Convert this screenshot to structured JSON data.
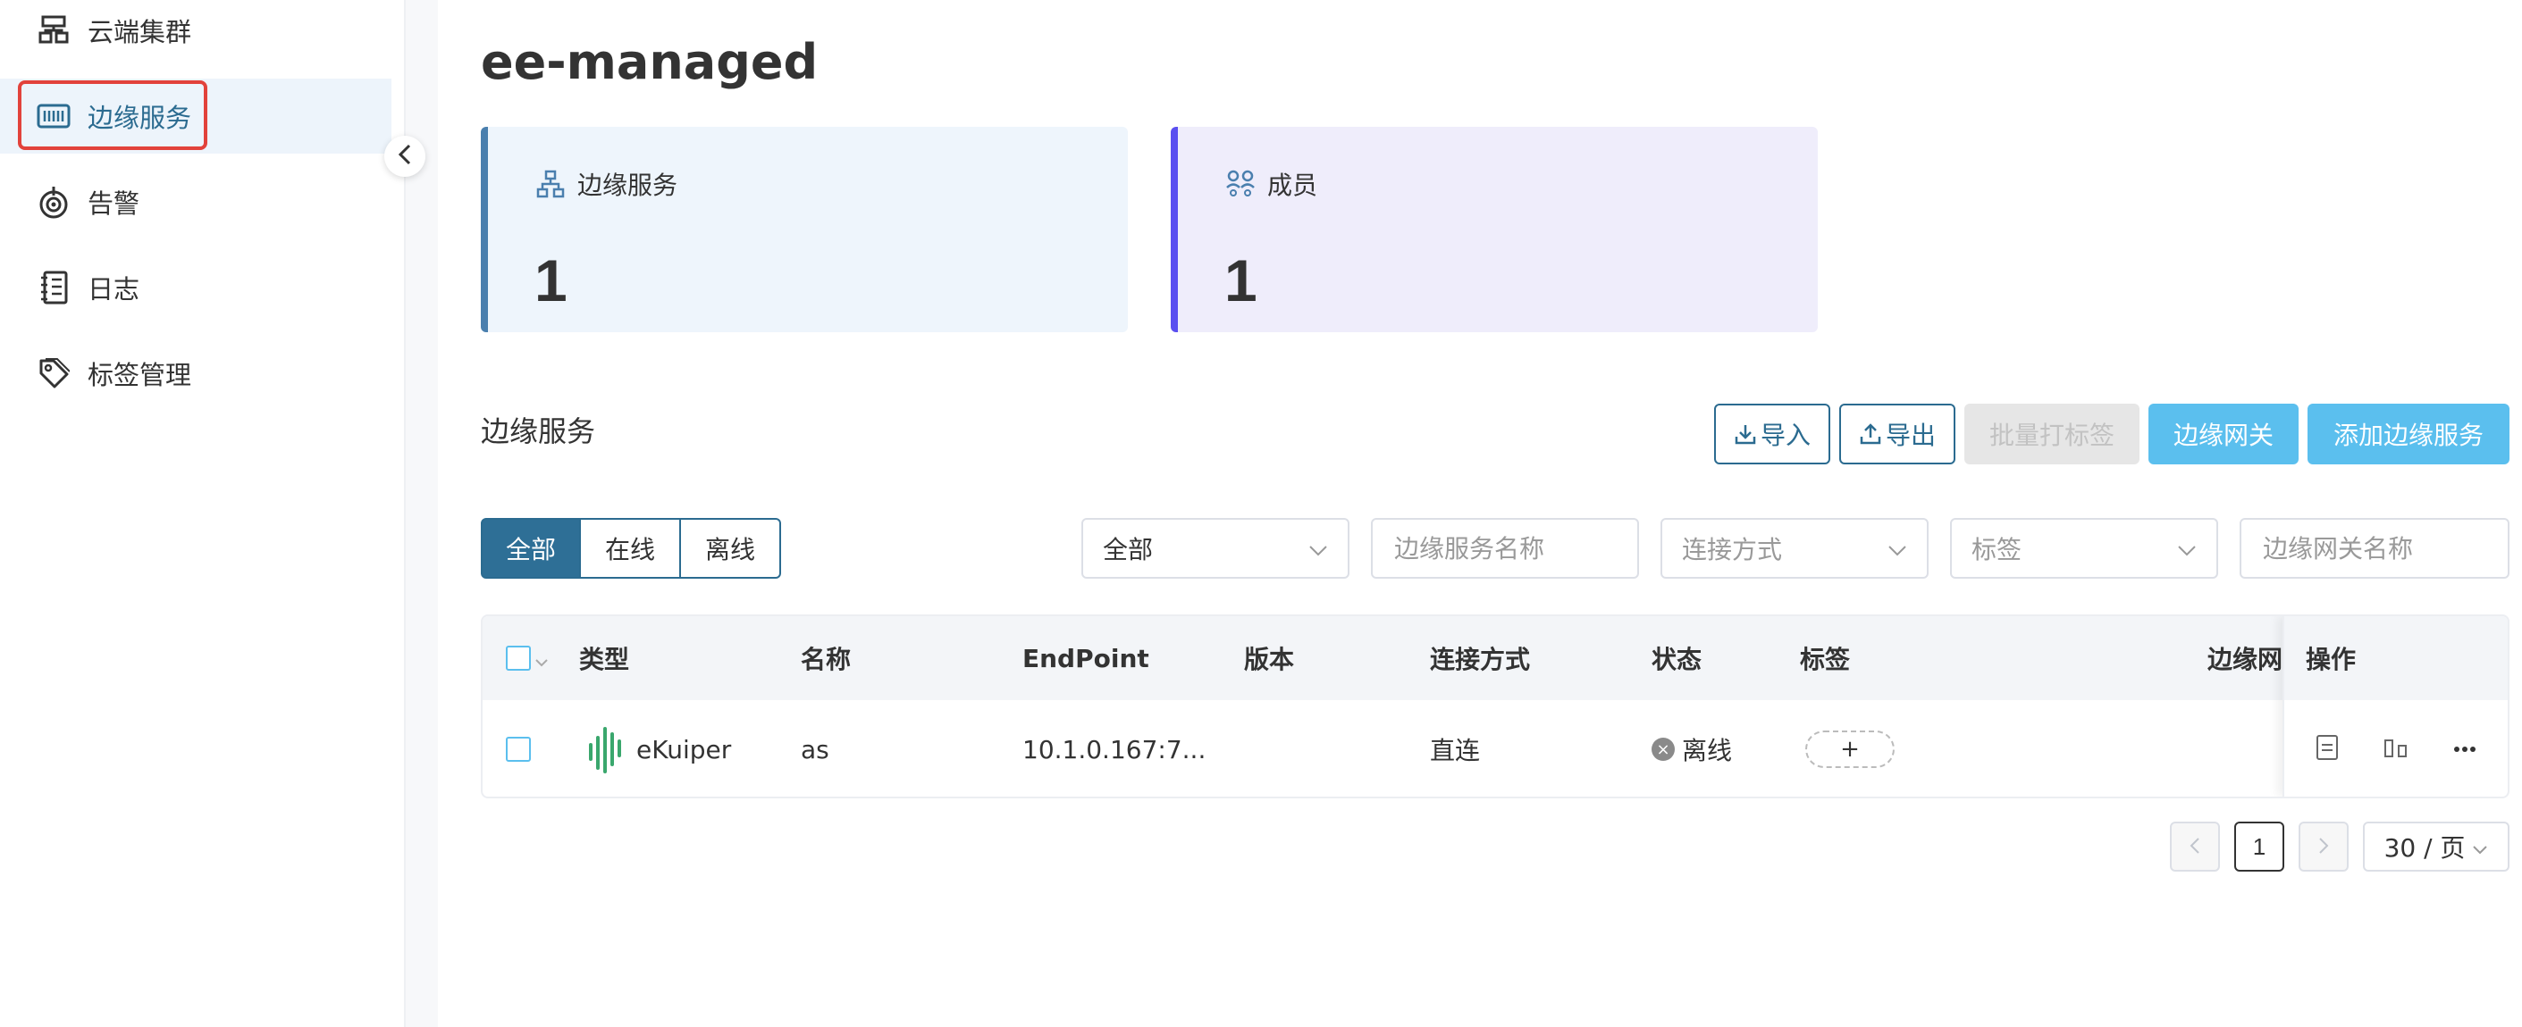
{
  "sidebar": {
    "items": [
      {
        "label": "云端集群",
        "icon": "cluster-icon"
      },
      {
        "label": "边缘服务",
        "icon": "edge-service-icon",
        "active": true
      },
      {
        "label": "告警",
        "icon": "alarm-icon"
      },
      {
        "label": "日志",
        "icon": "log-icon"
      },
      {
        "label": "标签管理",
        "icon": "tag-icon"
      }
    ]
  },
  "page": {
    "title": "ee-managed"
  },
  "stats": {
    "services": {
      "label": "边缘服务",
      "value": "1",
      "icon": "sitemap-icon",
      "accent": "#4a7fae"
    },
    "members": {
      "label": "成员",
      "value": "1",
      "icon": "members-icon",
      "accent": "#5a4ff0"
    }
  },
  "section": {
    "title": "边缘服务"
  },
  "toolbar": {
    "import_label": "导入",
    "export_label": "导出",
    "batch_tag_label": "批量打标签",
    "gateway_label": "边缘网关",
    "add_label": "添加边缘服务"
  },
  "status_filter": {
    "items": [
      "全部",
      "在线",
      "离线"
    ],
    "active": "全部"
  },
  "filters": {
    "type_select": "全部",
    "name_placeholder": "边缘服务名称",
    "connection_placeholder": "连接方式",
    "tag_placeholder": "标签",
    "gateway_placeholder": "边缘网关名称"
  },
  "table": {
    "columns": [
      "类型",
      "名称",
      "EndPoint",
      "版本",
      "连接方式",
      "状态",
      "标签",
      "边缘网关",
      "操作"
    ],
    "rows": [
      {
        "type": "eKuiper",
        "name": "as",
        "endpoint": "10.1.0.167:7...",
        "version": "",
        "connection": "直连",
        "status": "离线",
        "tag_add": "+"
      }
    ]
  },
  "pagination": {
    "current": "1",
    "page_size": "30 / 页",
    "prev_icon": "chevron-left-icon",
    "next_icon": "chevron-right-icon"
  },
  "colors": {
    "primary": "#2b6b90",
    "primary_light": "#5bbfee",
    "highlight": "#e2423b",
    "ekuiper_green": "#3aa76d"
  }
}
